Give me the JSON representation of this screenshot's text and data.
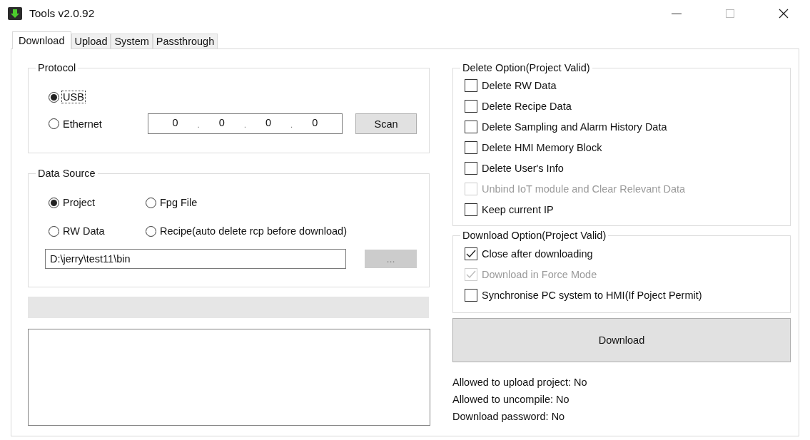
{
  "window": {
    "title": "Tools v2.0.92"
  },
  "tabs": [
    {
      "label": "Download",
      "selected": true
    },
    {
      "label": "Upload",
      "selected": false
    },
    {
      "label": "System",
      "selected": false
    },
    {
      "label": "Passthrough",
      "selected": false
    }
  ],
  "protocol": {
    "title": "Protocol",
    "options": [
      {
        "label": "USB",
        "selected": true,
        "focused": true
      },
      {
        "label": "Ethernet",
        "selected": false,
        "focused": false
      }
    ],
    "ip": [
      "0",
      "0",
      "0",
      "0"
    ],
    "ip_separator": ".",
    "scan_button": "Scan"
  },
  "data_source": {
    "title": "Data Source",
    "options": [
      {
        "label": "Project",
        "selected": true
      },
      {
        "label": "Fpg File",
        "selected": false
      },
      {
        "label": "RW Data",
        "selected": false
      },
      {
        "label": "Recipe(auto delete rcp before download)",
        "selected": false
      }
    ],
    "path": "D:\\jerry\\test11\\bin",
    "browse_button": {
      "label": "...",
      "disabled": true
    }
  },
  "progress": {
    "level": 0
  },
  "delete_option": {
    "title": "Delete Option(Project Valid)",
    "items": [
      {
        "label": "Delete RW Data",
        "checked": false,
        "disabled": false
      },
      {
        "label": "Delete Recipe Data",
        "checked": false,
        "disabled": false
      },
      {
        "label": "Delete Sampling and Alarm History Data",
        "checked": false,
        "disabled": false
      },
      {
        "label": "Delete HMI Memory Block",
        "checked": false,
        "disabled": false
      },
      {
        "label": "Delete User's Info",
        "checked": false,
        "disabled": false
      },
      {
        "label": "Unbind IoT module and Clear Relevant Data",
        "checked": false,
        "disabled": true
      },
      {
        "label": "Keep current IP",
        "checked": false,
        "disabled": false
      }
    ]
  },
  "download_option": {
    "title": "Download Option(Project Valid)",
    "items": [
      {
        "label": "Close after downloading",
        "checked": true,
        "disabled": false
      },
      {
        "label": "Download in Force Mode",
        "checked": true,
        "disabled": true
      },
      {
        "label": "Synchronise PC system to HMI(If Poject Permit)",
        "checked": false,
        "disabled": false
      }
    ]
  },
  "download_button": "Download",
  "info": [
    "Allowed to upload project: No",
    "Allowed to uncompile: No",
    "Download password: No"
  ]
}
